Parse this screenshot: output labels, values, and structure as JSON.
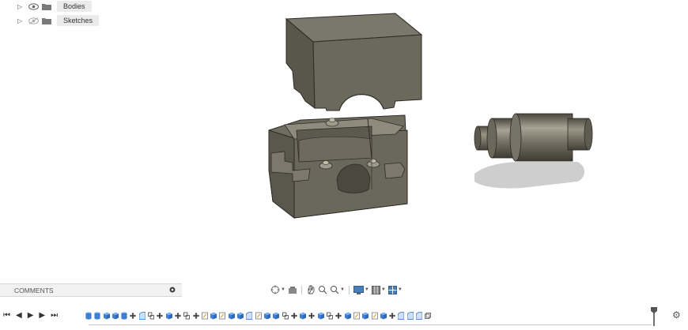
{
  "browser": {
    "items": [
      {
        "label": "Bodies",
        "visible": true
      },
      {
        "label": "Sketches",
        "visible": false
      }
    ]
  },
  "comments": {
    "label": "COMMENTS"
  },
  "nav_toolbar": {
    "tools": [
      "orbit-icon",
      "look-at-icon",
      "pan-icon",
      "zoom-icon",
      "fit-icon",
      "display-settings-icon",
      "grid-settings-icon",
      "viewports-icon"
    ]
  },
  "timeline": {
    "controls": [
      "skip-start-icon",
      "step-back-icon",
      "play-icon",
      "step-forward-icon",
      "skip-end-icon"
    ],
    "features": [
      "extrude",
      "extrude",
      "box",
      "box",
      "extrude",
      "move",
      "fillet",
      "combine",
      "move",
      "box",
      "move",
      "combine",
      "move",
      "sketch",
      "box",
      "sketch",
      "box",
      "box",
      "fillet",
      "sketch",
      "box",
      "box",
      "combine",
      "move",
      "box",
      "move",
      "box",
      "combine",
      "move",
      "box",
      "sketch",
      "box",
      "sketch",
      "box",
      "move",
      "fillet",
      "fillet",
      "fillet",
      "shell"
    ],
    "colors": {
      "feature": "#3d7fd3",
      "sketch": "#d9a441",
      "move": "#333333"
    }
  }
}
